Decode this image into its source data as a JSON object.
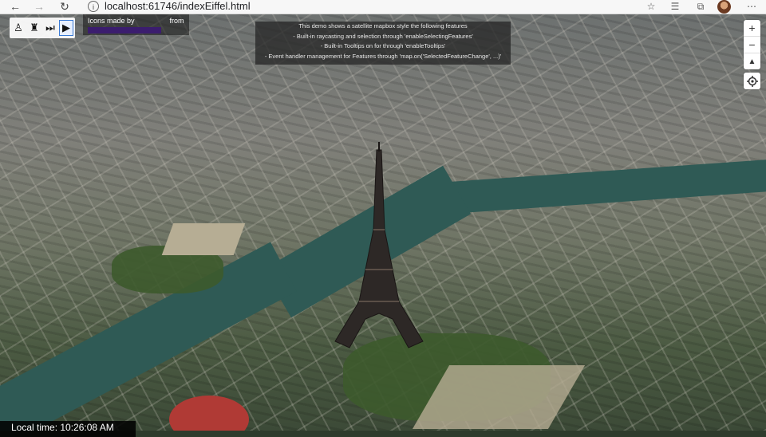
{
  "browser": {
    "url": "localhost:61746/indexEiffel.html"
  },
  "icons": {
    "back": "arrow-left-icon",
    "forward": "arrow-right-icon",
    "reload": "reload-icon",
    "site_info": "info-icon",
    "favorite": "star-icon",
    "favorites_bar": "favorites-icon",
    "collections": "collections-icon",
    "profile": "avatar",
    "menu": "more-icon"
  },
  "toolbar": {
    "buttons": [
      {
        "icon": "statue-of-liberty-icon",
        "glyph": "♙"
      },
      {
        "icon": "eiffel-tower-icon",
        "glyph": "♜"
      },
      {
        "icon": "skip-forward-icon",
        "glyph": "⏭"
      },
      {
        "icon": "play-icon",
        "glyph": "▶"
      }
    ],
    "active_index": 3
  },
  "credits": {
    "text_made_by": "Icons made by",
    "text_from": "from"
  },
  "info": {
    "lines": [
      "This demo shows a satellite mapbox style the following features",
      "- Built-in raycasting and selection through 'enableSelectingFeatures'",
      "- Built-in Tooltips on for through 'enableTooltips'",
      "- Event handler management for Features through 'map.on('SelectedFeatureChange', ...)'"
    ]
  },
  "map_controls": {
    "zoom_in": "+",
    "zoom_out": "−",
    "compass": "▲",
    "locate_icon": "crosshair-icon"
  },
  "clock": {
    "text": "Local time: 10:26:08 AM"
  },
  "colors": {
    "accent": "#3a7bd5",
    "info_bg": "#282828",
    "credit_bar": "#3b1d6e"
  }
}
